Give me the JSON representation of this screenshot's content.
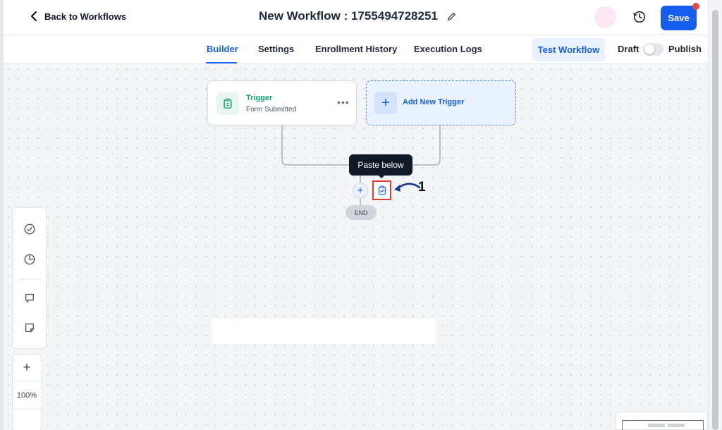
{
  "header": {
    "back_label": "Back to Workflows",
    "workflow_title": "New Workflow : 1755494728251",
    "save_label": "Save"
  },
  "tabs": [
    {
      "label": "Builder",
      "active": true
    },
    {
      "label": "Settings",
      "active": false
    },
    {
      "label": "Enrollment History",
      "active": false
    },
    {
      "label": "Execution Logs",
      "active": false
    }
  ],
  "actions": {
    "test_label": "Test Workflow",
    "draft_label": "Draft",
    "publish_label": "Publish",
    "published": false
  },
  "trigger": {
    "title": "Trigger",
    "subtitle": "Form Submitted",
    "more": "•••"
  },
  "add_trigger": {
    "plus": "+",
    "label": "Add New Trigger"
  },
  "tooltip": "Paste below",
  "nodes": {
    "add_plus": "+",
    "end_label": "END"
  },
  "annotation": {
    "step_number": "1"
  },
  "zoom": {
    "plus": "+",
    "level": "100%"
  },
  "colors": {
    "primary": "#155eef",
    "trigger_green": "#0e9f6e",
    "highlight_red": "#e53935",
    "notification_dot": "#ef4444"
  },
  "icons": {
    "back": "chevron-left-icon",
    "edit": "pencil-icon",
    "history": "history-icon",
    "trigger": "clipboard-icon",
    "paste": "clipboard-check-icon",
    "side_tools": [
      "check-circle-icon",
      "pie-chart-icon",
      "comment-icon",
      "sticky-note-icon"
    ]
  }
}
